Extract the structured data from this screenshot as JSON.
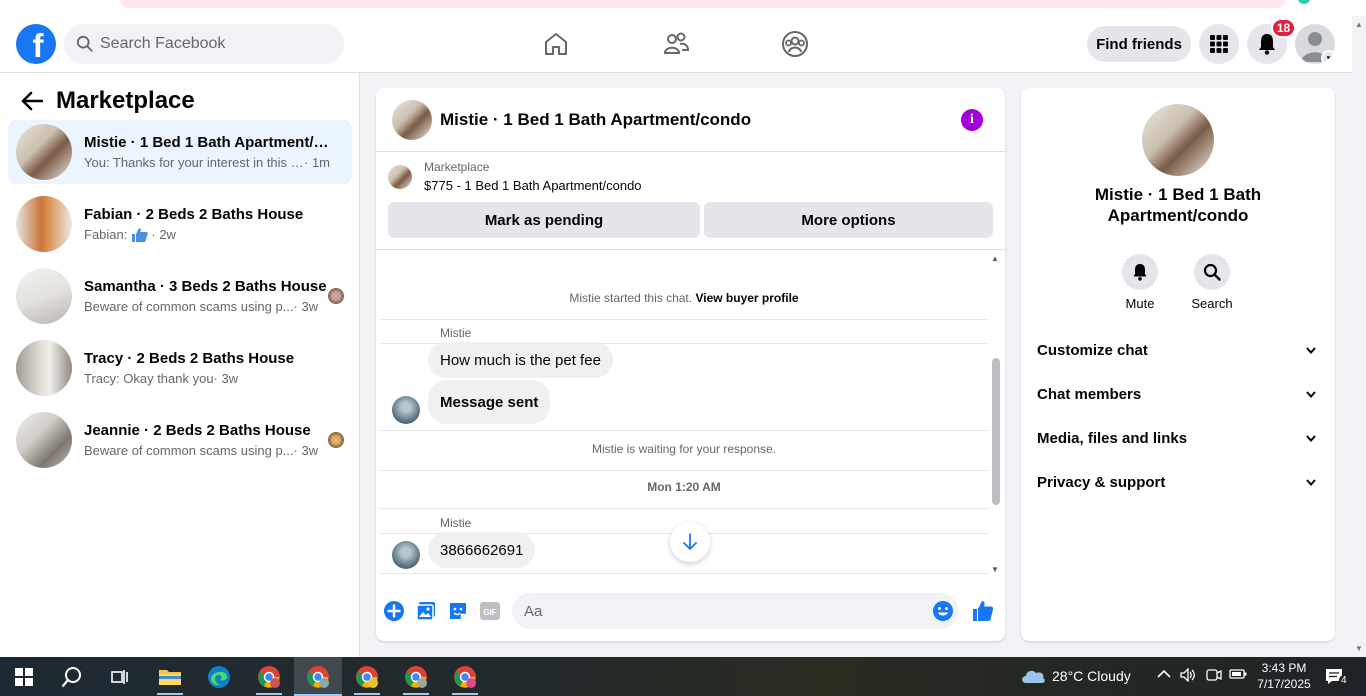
{
  "header": {
    "search_placeholder": "Search Facebook",
    "find_friends": "Find friends",
    "notifications_count": "18"
  },
  "sidebar": {
    "title": "Marketplace",
    "conversations": [
      {
        "title": "Mistie · 1 Bed 1 Bath Apartment/condo",
        "preview": "You: Thanks for your interest in this h...",
        "time": "· 1m",
        "active": true
      },
      {
        "title": "Fabian · 2 Beds 2 Baths House",
        "preview": "Fabian:",
        "time": "· 2w",
        "active": false
      },
      {
        "title": "Samantha · 3 Beds 2 Baths House",
        "preview": "Beware of common scams using p...",
        "time": "· 3w",
        "active": false
      },
      {
        "title": "Tracy · 2 Beds 2 Baths House",
        "preview": "Tracy: Okay thank you",
        "time": "· 3w",
        "active": false
      },
      {
        "title": "Jeannie · 2 Beds 2 Baths House",
        "preview": "Beware of common scams using p...",
        "time": "· 3w",
        "active": false
      }
    ]
  },
  "chat": {
    "title": "Mistie · 1 Bed 1 Bath Apartment/condo",
    "listing_source": "Marketplace",
    "listing_detail": "$775 - 1 Bed 1 Bath Apartment/condo",
    "mark_pending": "Mark as pending",
    "more_options": "More options",
    "started_text": "Mistie started this chat.",
    "view_buyer_profile": "View buyer profile",
    "sender_1": "Mistie",
    "message_1": "How much is the pet fee",
    "message_2": "Message sent",
    "waiting_text": "Mistie is waiting for your response.",
    "timestamp": "Mon 1:20 AM",
    "sender_2": "Mistie",
    "message_3": "3866662691",
    "composer_placeholder": "Aa"
  },
  "details": {
    "name": "Mistie · 1 Bed 1 Bath Apartment/condo",
    "mute_label": "Mute",
    "search_label": "Search",
    "sections": [
      "Customize chat",
      "Chat members",
      "Media, files and links",
      "Privacy & support"
    ]
  },
  "taskbar": {
    "weather": "28°C  Cloudy",
    "time": "3:43 PM",
    "date": "7/17/2025",
    "notif_count": "4"
  },
  "colors": {
    "brand_blue": "#1877f2",
    "active_row": "#ebf5ff",
    "info_purple": "#a100d8",
    "badge_red": "#e41e3f"
  }
}
